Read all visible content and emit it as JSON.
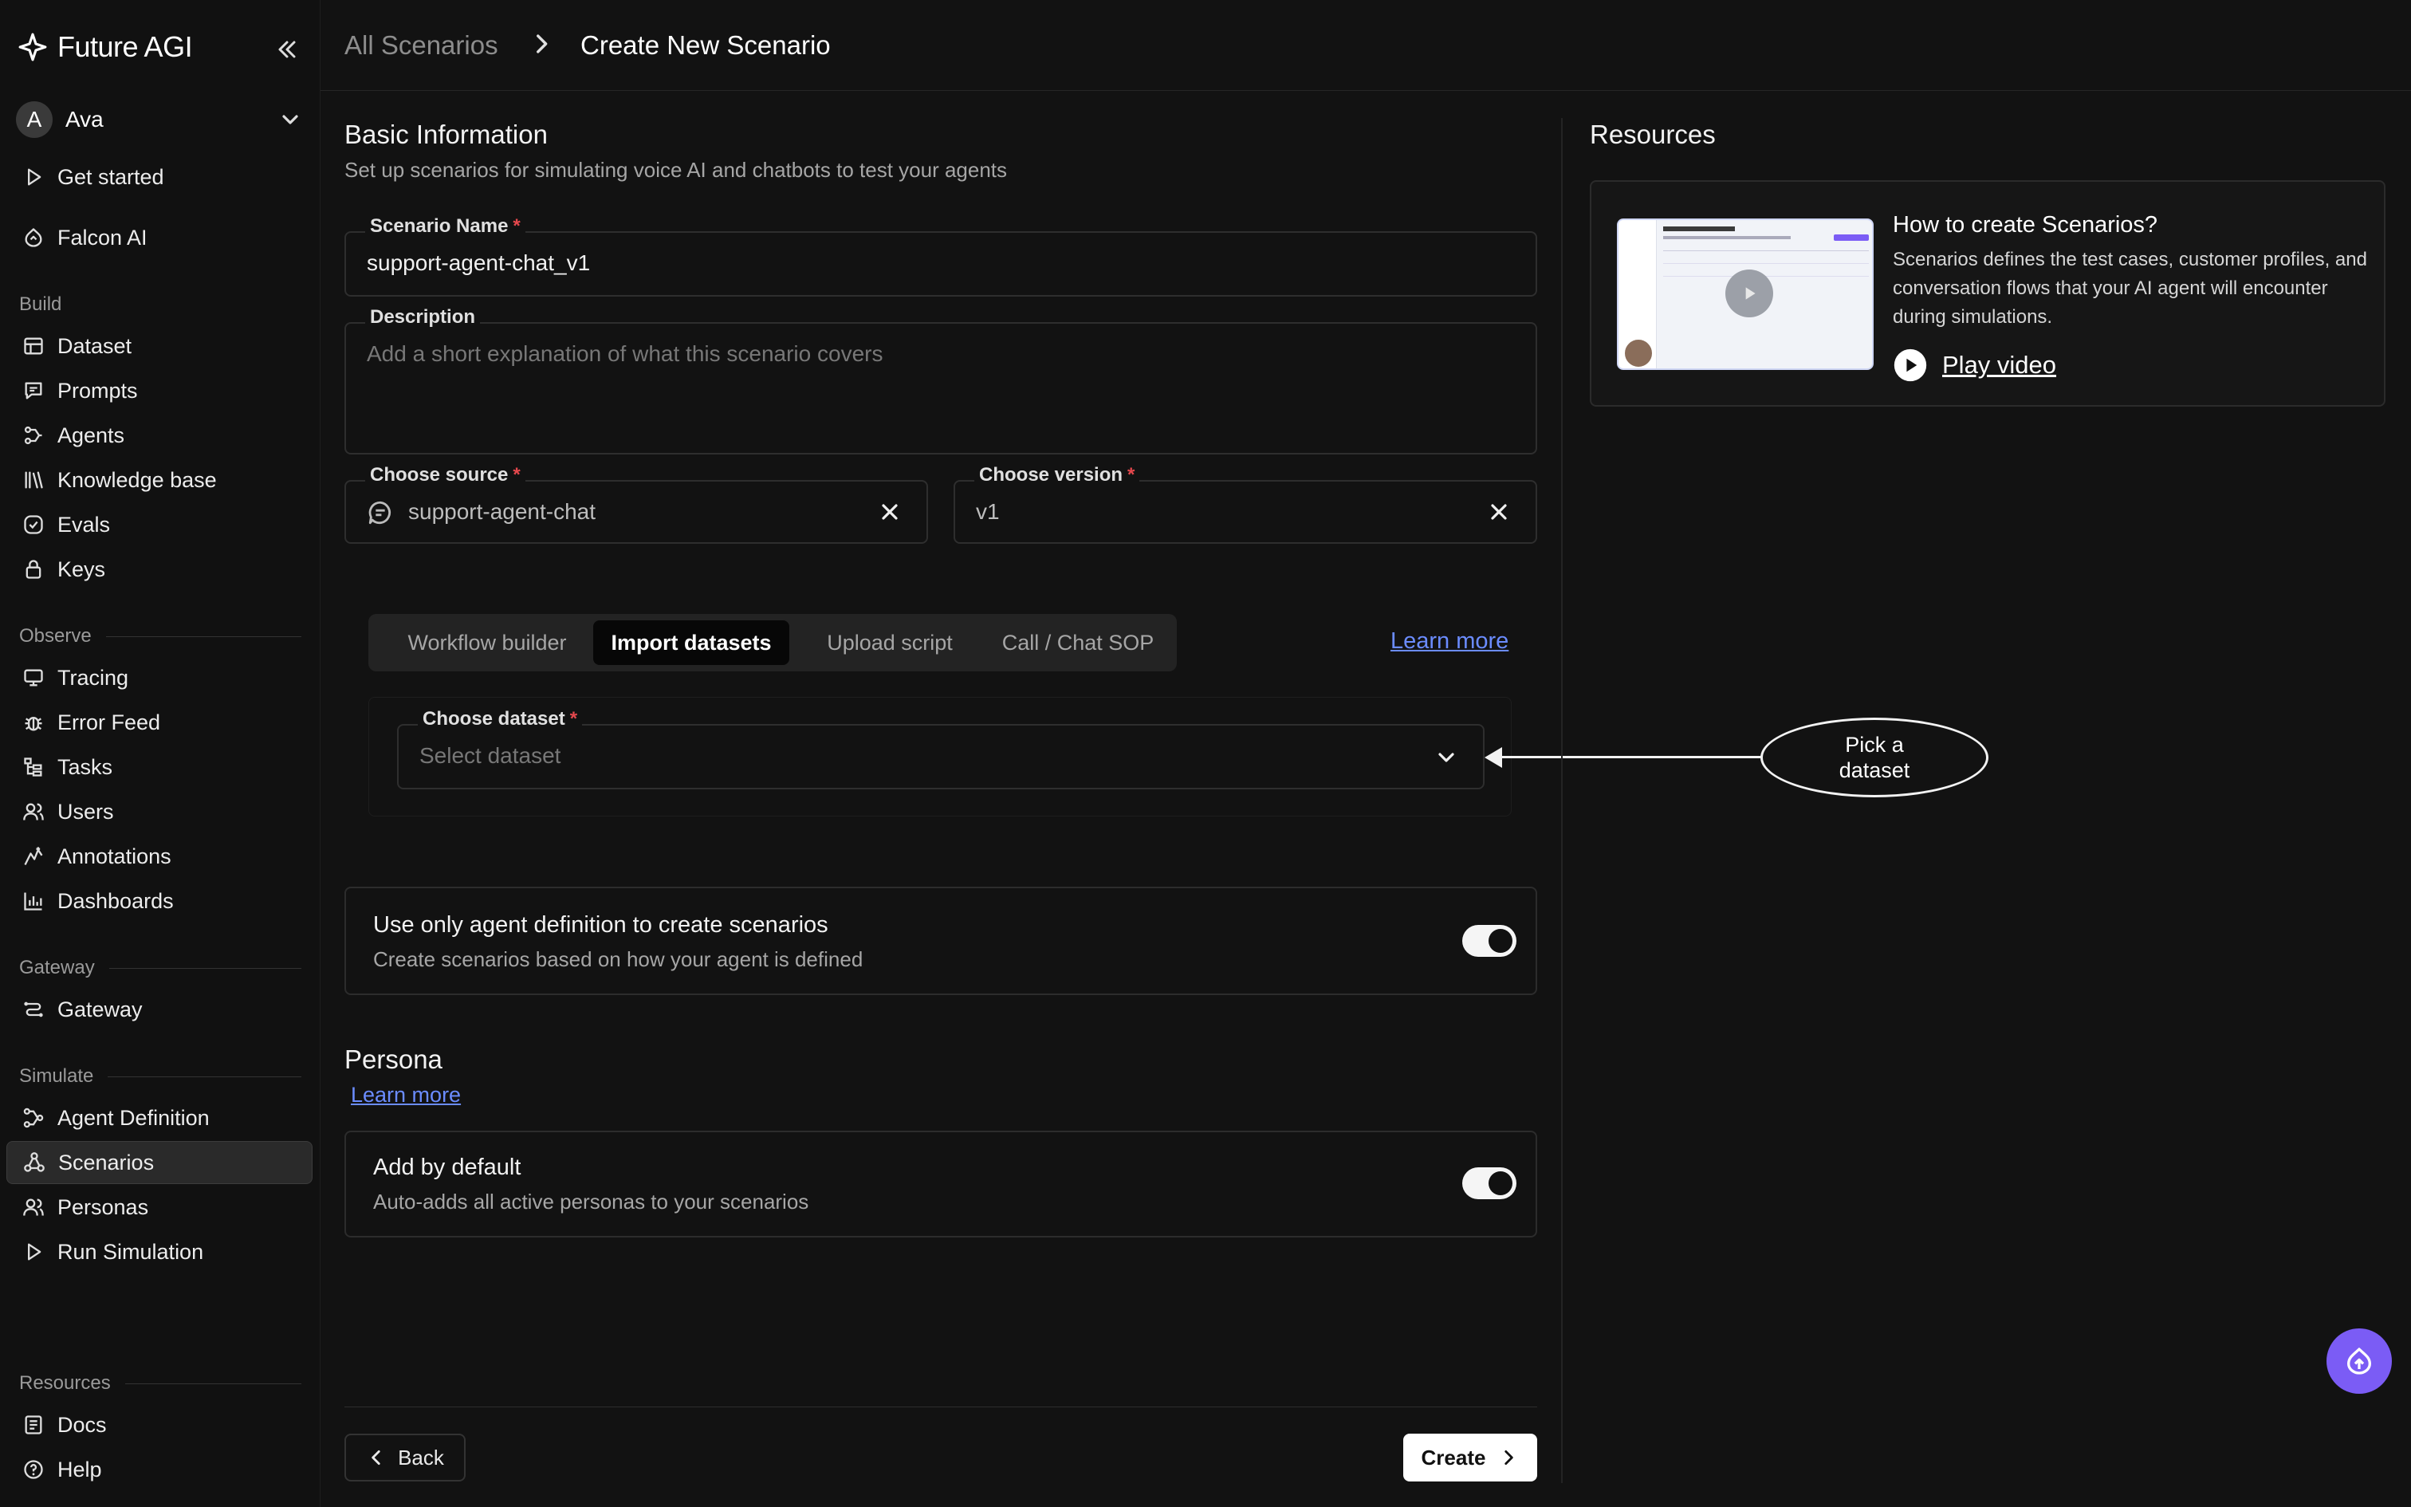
{
  "brand": {
    "name": "Future AGI"
  },
  "user": {
    "initial": "A",
    "name": "Ava"
  },
  "nav": {
    "top": [
      {
        "label": "Get started",
        "icon": "play-icon"
      },
      {
        "label": "Falcon AI",
        "icon": "falcon-icon"
      }
    ],
    "sections": [
      {
        "title": "Build",
        "items": [
          "Dataset",
          "Prompts",
          "Agents",
          "Knowledge base",
          "Evals",
          "Keys"
        ]
      },
      {
        "title": "Observe",
        "items": [
          "Tracing",
          "Error Feed",
          "Tasks",
          "Users",
          "Annotations",
          "Dashboards"
        ]
      },
      {
        "title": "Gateway",
        "items": [
          "Gateway"
        ]
      },
      {
        "title": "Simulate",
        "items": [
          "Agent Definition",
          "Scenarios",
          "Personas",
          "Run Simulation"
        ]
      },
      {
        "title": "Resources",
        "items": [
          "Docs",
          "Help"
        ]
      }
    ],
    "active": "Scenarios"
  },
  "breadcrumb": {
    "parent": "All Scenarios",
    "current": "Create New Scenario"
  },
  "basic": {
    "title": "Basic Information",
    "subtitle": "Set up scenarios for simulating voice AI and chatbots to test your agents"
  },
  "form": {
    "name_label": "Scenario Name",
    "name_value": "support-agent-chat_v1",
    "desc_label": "Description",
    "desc_placeholder": "Add a short explanation of what this scenario covers",
    "source_label": "Choose source",
    "source_value": "support-agent-chat",
    "version_label": "Choose version",
    "version_value": "v1",
    "required_mark": "*"
  },
  "tabs": {
    "items": [
      "Workflow builder",
      "Import datasets",
      "Upload script",
      "Call / Chat SOP"
    ],
    "active": "Import datasets",
    "learn_more": "Learn more"
  },
  "dataset": {
    "label": "Choose dataset",
    "placeholder": "Select dataset"
  },
  "callout": {
    "line1": "Pick a",
    "line2": "dataset"
  },
  "agent_def_card": {
    "title": "Use only agent definition to create scenarios",
    "subtitle": "Create scenarios based on how your agent is defined",
    "enabled": true
  },
  "persona": {
    "title": "Persona",
    "learn_more": "Learn more",
    "card_title": "Add by default",
    "card_subtitle": "Auto-adds all active personas to your scenarios",
    "enabled": true
  },
  "resources": {
    "title": "Resources",
    "card_title": "How to create Scenarios?",
    "card_desc": "Scenarios defines the test cases, customer profiles, and conversation flows that your AI agent will encounter during simulations.",
    "play_label": "Play video"
  },
  "footer": {
    "back_label": "Back",
    "create_label": "Create"
  },
  "colors": {
    "accent_link": "#6b8cff",
    "required": "#e5484d",
    "fab": "#7b5cf5"
  }
}
